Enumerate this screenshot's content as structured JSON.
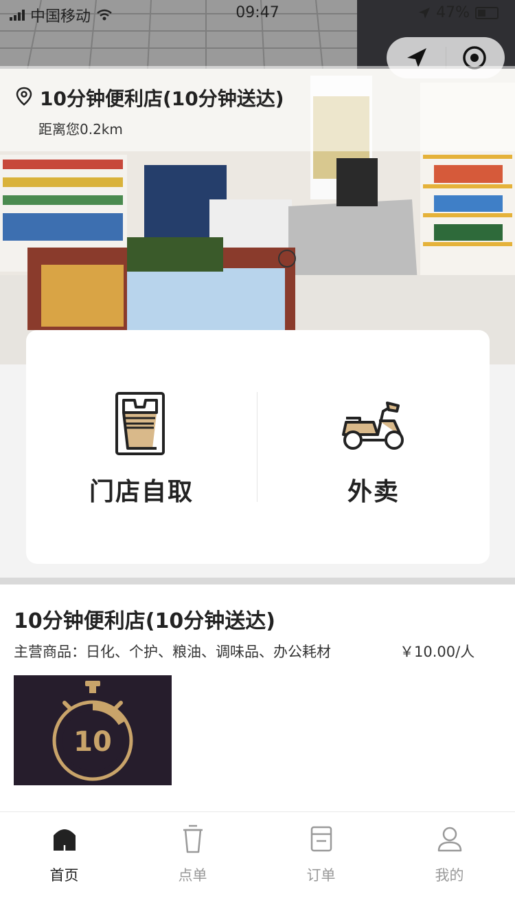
{
  "status_bar": {
    "carrier": "中国移动",
    "time": "09:47",
    "battery": "47%"
  },
  "store_header": {
    "name": "10分钟便利店(10分钟送达)",
    "distance": "距离您0.2km"
  },
  "order_options": [
    {
      "label": "门店自取",
      "icon": "cup-pickup-icon"
    },
    {
      "label": "外卖",
      "icon": "scooter-icon"
    }
  ],
  "store_detail": {
    "title": "10分钟便利店(10分钟送达)",
    "description": "主营商品：日化、个护、粮油、调味品、办公耗材",
    "price": "￥10.00/人",
    "logo_text": "10"
  },
  "tab_bar": {
    "items": [
      {
        "label": "首页",
        "icon": "home-icon",
        "active": true
      },
      {
        "label": "点单",
        "icon": "cup-icon",
        "active": false
      },
      {
        "label": "订单",
        "icon": "order-icon",
        "active": false
      },
      {
        "label": "我的",
        "icon": "user-icon",
        "active": false
      }
    ]
  },
  "colors": {
    "accent_tan": "#d9b98a",
    "logo_bg": "#261d2c",
    "logo_gold": "#c9a46a"
  }
}
